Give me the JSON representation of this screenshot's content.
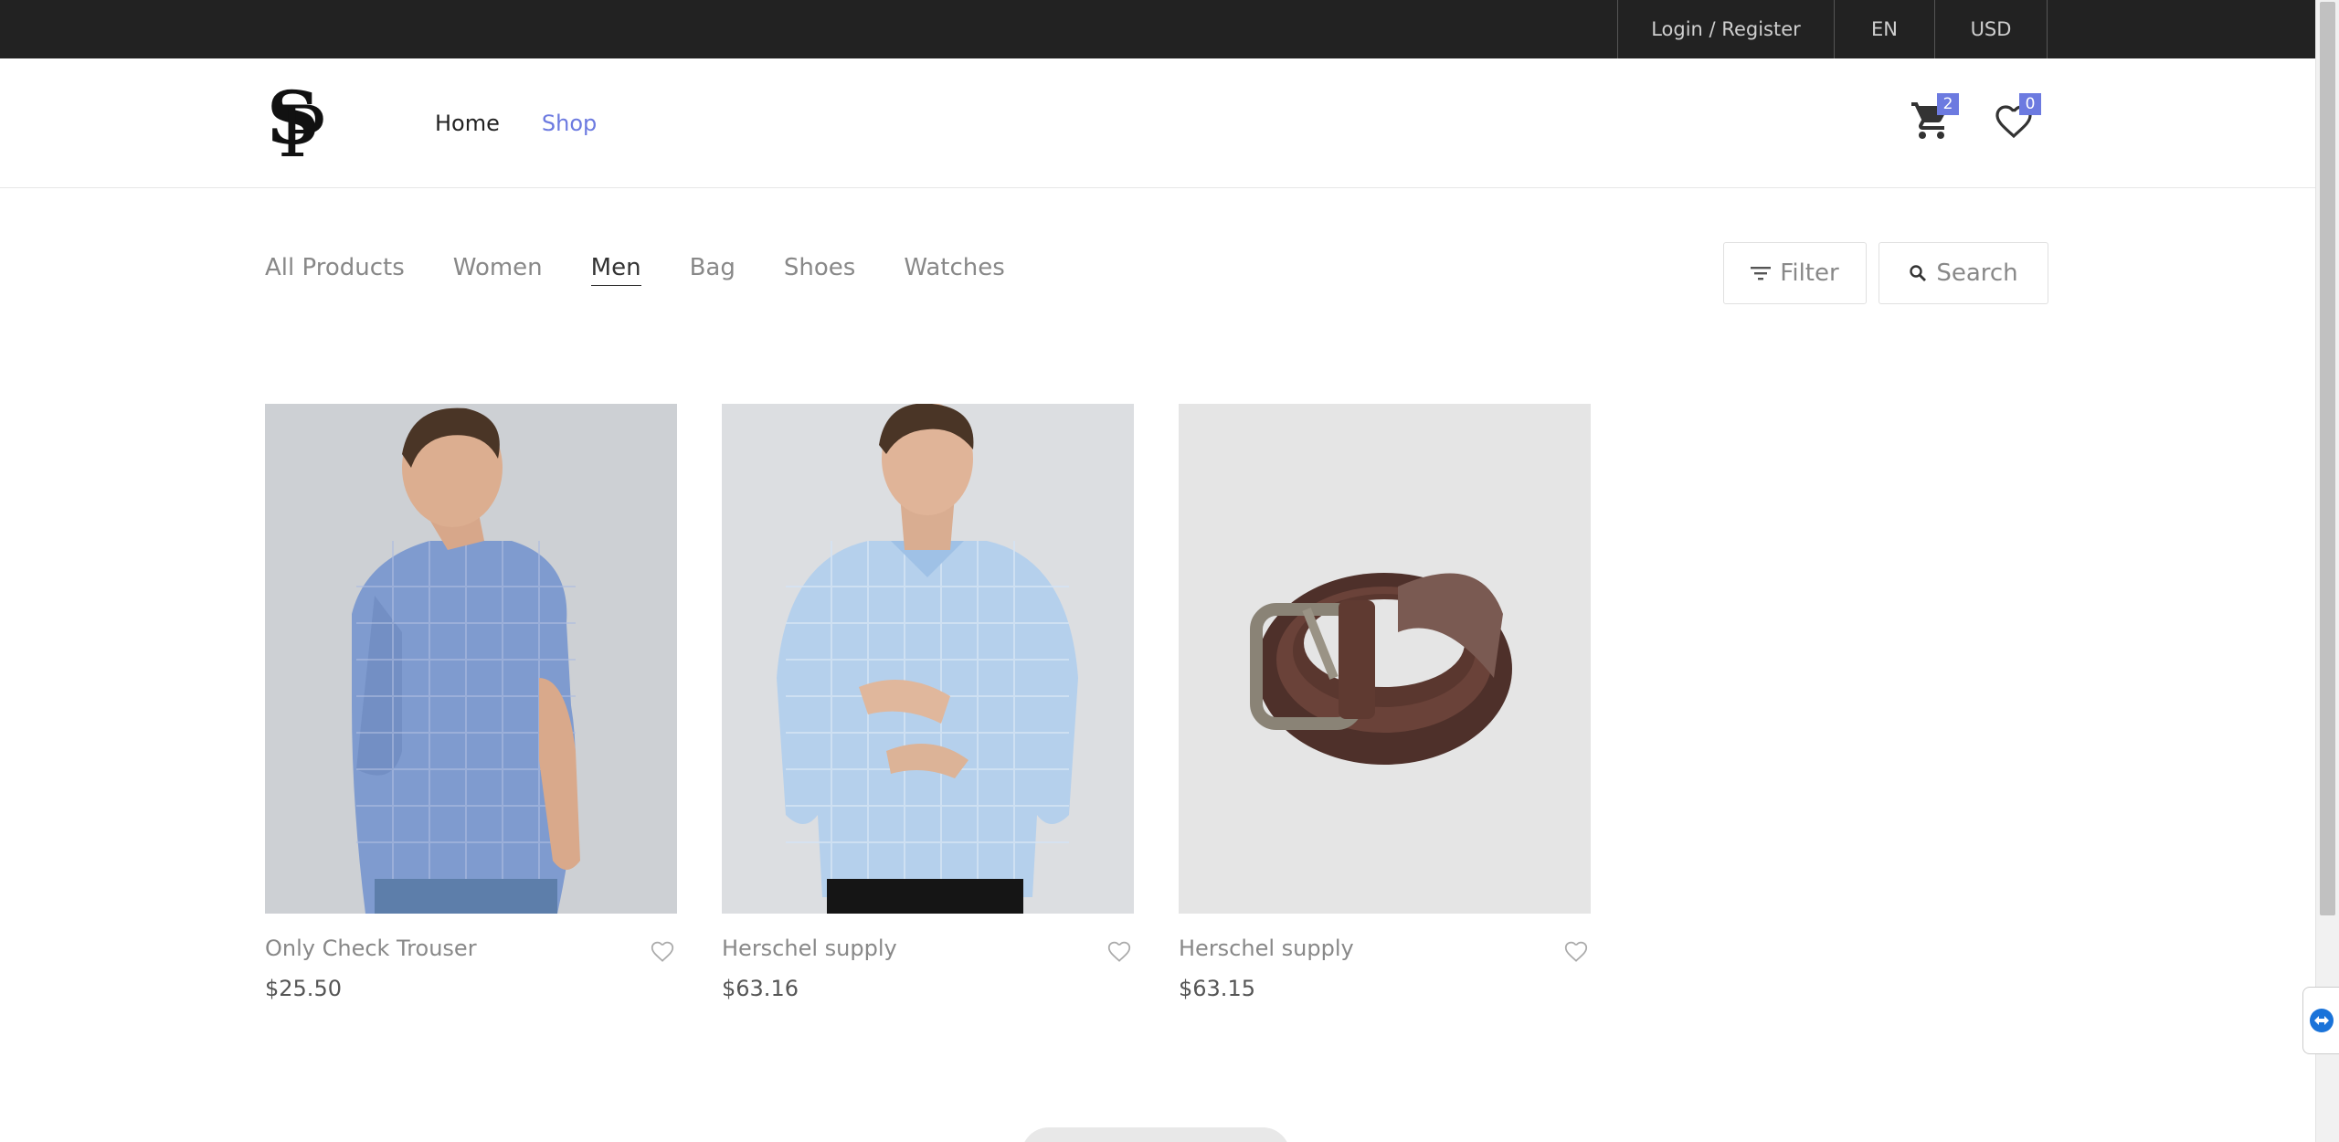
{
  "topbar": {
    "login_label": "Login / Register",
    "language": "EN",
    "currency": "USD"
  },
  "header": {
    "nav": [
      {
        "label": "Home",
        "active": false
      },
      {
        "label": "Shop",
        "active": true
      }
    ],
    "cart_count": "2",
    "wishlist_count": "0",
    "accent_color": "#6c7ae0"
  },
  "categories": [
    {
      "label": "All Products",
      "active": false
    },
    {
      "label": "Women",
      "active": false
    },
    {
      "label": "Men",
      "active": true
    },
    {
      "label": "Bag",
      "active": false
    },
    {
      "label": "Shoes",
      "active": false
    },
    {
      "label": "Watches",
      "active": false
    }
  ],
  "tools": {
    "filter_label": "Filter",
    "search_label": "Search"
  },
  "products": [
    {
      "name": "Only Check Trouser",
      "price": "$25.50",
      "image": "blue-check-shirt-model"
    },
    {
      "name": "Herschel supply",
      "price": "$63.16",
      "image": "light-blue-shirt-model"
    },
    {
      "name": "Herschel supply",
      "price": "$63.15",
      "image": "brown-leather-belt"
    }
  ]
}
